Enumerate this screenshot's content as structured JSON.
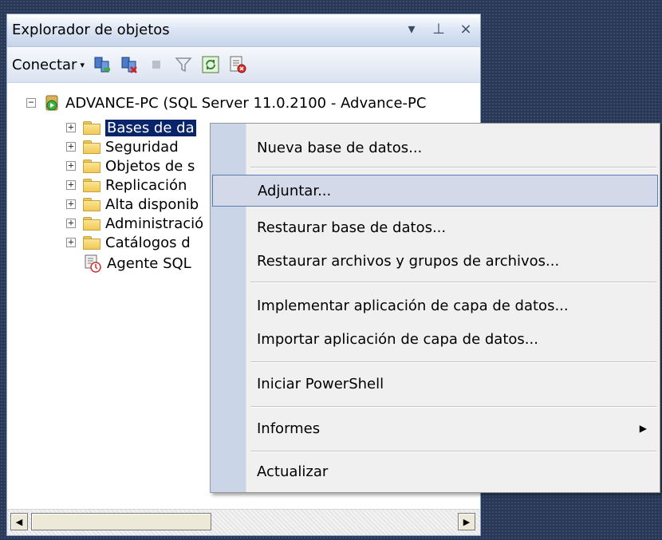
{
  "panel": {
    "title": "Explorador de objetos",
    "controls": {
      "dropdown": "▾",
      "pin": "⊥",
      "close": "×"
    }
  },
  "toolbar": {
    "connect_label": "Conectar",
    "caret": "▾",
    "icons": [
      "connect-server-icon",
      "disconnect-server-icon",
      "stop-icon",
      "filter-icon",
      "refresh-icon",
      "new-query-icon"
    ]
  },
  "tree": {
    "root": {
      "expander": "−",
      "label": "ADVANCE-PC (SQL Server 11.0.2100 - Advance-PC"
    },
    "children": [
      {
        "expander": "+",
        "label": "Bases de da"
      },
      {
        "expander": "+",
        "label": "Seguridad"
      },
      {
        "expander": "+",
        "label": "Objetos de s"
      },
      {
        "expander": "+",
        "label": "Replicación"
      },
      {
        "expander": "+",
        "label": "Alta disponib"
      },
      {
        "expander": "+",
        "label": "Administració"
      },
      {
        "expander": "+",
        "label": "Catálogos d"
      }
    ],
    "agent": {
      "label": "Agente SQL"
    }
  },
  "scrollbar": {
    "left": "◀",
    "right": "▶"
  },
  "context_menu": {
    "items": [
      {
        "label": "Nueva base de datos..."
      },
      {
        "label": "Adjuntar..."
      },
      {
        "label": "Restaurar base de datos..."
      },
      {
        "label": "Restaurar archivos y grupos de archivos..."
      },
      {
        "label": "Implementar aplicación de capa de datos..."
      },
      {
        "label": "Importar aplicación de capa de datos..."
      },
      {
        "label": "Iniciar PowerShell"
      },
      {
        "label": "Informes",
        "submenu_arrow": "▶"
      },
      {
        "label": "Actualizar"
      }
    ],
    "highlight_color": "#d4d9ea",
    "highlight_border": "#5a7ab0"
  }
}
